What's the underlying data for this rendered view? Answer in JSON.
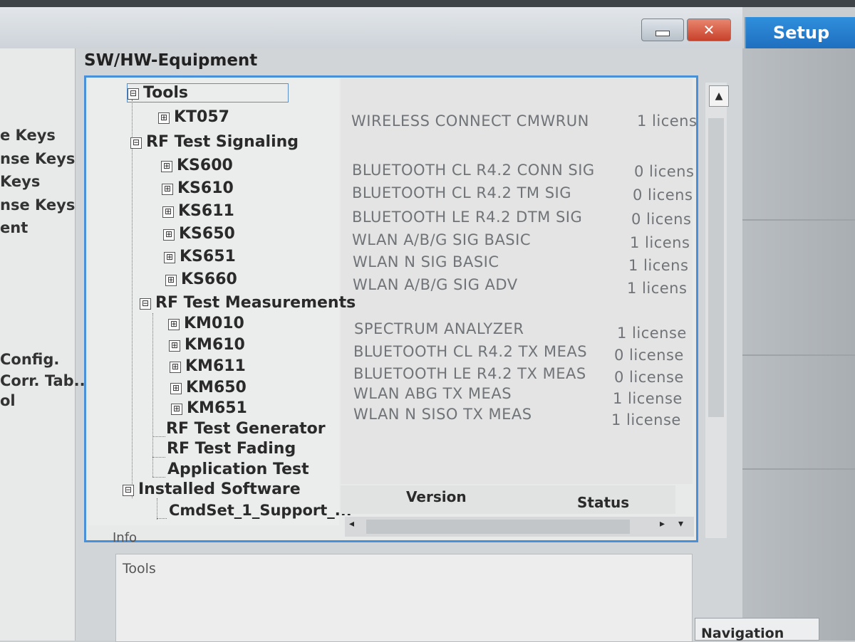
{
  "window": {
    "minimize_label": "",
    "close_label": "✕"
  },
  "setup_button": "Setup",
  "navigation_button": "Navigation",
  "left_sidebar": [
    "e Keys",
    "nse Keys",
    "Keys",
    "nse Keys",
    "ent",
    "Config.",
    " Corr. Tab...",
    "ol"
  ],
  "panel_title": "SW/HW-Equipment",
  "tree": {
    "tools": "Tools",
    "kt057": "KT057",
    "rf_signaling": "RF Test Signaling",
    "ks600": "KS600",
    "ks610": "KS610",
    "ks611": "KS611",
    "ks650": "KS650",
    "ks651": "KS651",
    "ks660": "KS660",
    "rf_measurements": "RF Test Measurements",
    "km010": "KM010",
    "km610": "KM610",
    "km611": "KM611",
    "km650": "KM650",
    "km651": "KM651",
    "rf_generator": "RF Test Generator",
    "rf_fading": "RF Test Fading",
    "application_test": "Application Test",
    "installed_software": "Installed Software",
    "cmdset": "CmdSet_1_Support_..."
  },
  "licenses": [
    {
      "name": "WIRELESS CONNECT CMWRUN",
      "count": "1 licens"
    },
    {
      "name": "BLUETOOTH CL R4.2 CONN SIG",
      "count": "0 licens"
    },
    {
      "name": "BLUETOOTH CL R4.2 TM SIG",
      "count": "0 licens"
    },
    {
      "name": "BLUETOOTH LE R4.2 DTM SIG",
      "count": "0 licens"
    },
    {
      "name": "WLAN A/B/G SIG BASIC",
      "count": "1 licens"
    },
    {
      "name": "WLAN N SIG BASIC",
      "count": "1 licens"
    },
    {
      "name": "WLAN A/B/G SIG ADV",
      "count": "1 licens"
    },
    {
      "name": "SPECTRUM ANALYZER",
      "count": "1 license"
    },
    {
      "name": "BLUETOOTH CL R4.2 TX MEAS",
      "count": "0 license"
    },
    {
      "name": "BLUETOOTH LE R4.2 TX MEAS",
      "count": "0 license"
    },
    {
      "name": "WLAN ABG TX MEAS",
      "count": "1 license"
    },
    {
      "name": "WLAN N SISO TX MEAS",
      "count": "1 license"
    }
  ],
  "software_table": {
    "version_header": "Version",
    "status_header": "Status"
  },
  "info": {
    "label": "Info",
    "text": "Tools"
  },
  "icons": {
    "expand": "⊞",
    "collapse": "⊟",
    "scroll_up": "▲",
    "scroll_left": "◂",
    "scroll_right": "▸",
    "scroll_down": "▾"
  }
}
